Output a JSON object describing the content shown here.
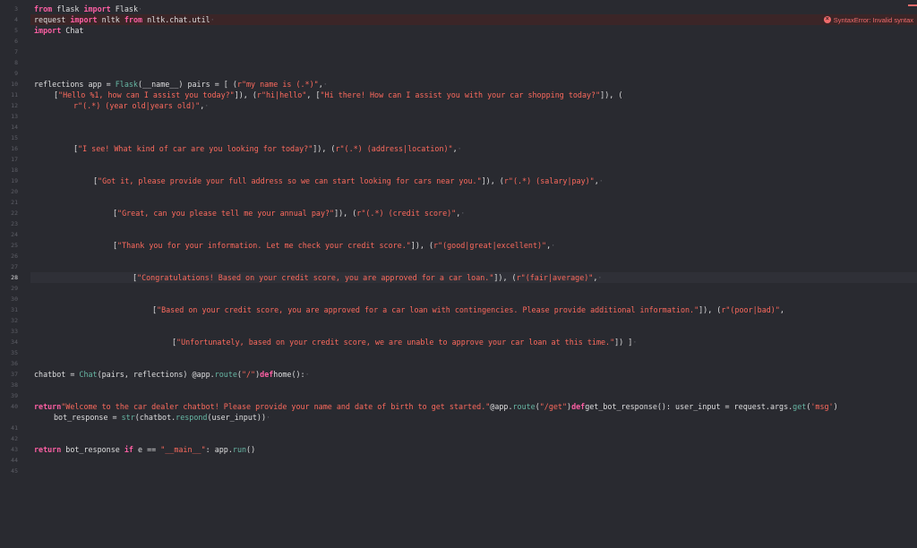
{
  "editor": {
    "line_numbers": [
      "3",
      "4",
      "5",
      "6",
      "7",
      "8",
      "9",
      "10",
      "11",
      "12",
      "13",
      "14",
      "15",
      "16",
      "17",
      "18",
      "19",
      "20",
      "21",
      "22",
      "23",
      "24",
      "25",
      "26",
      "27",
      "28",
      "29",
      "30",
      "31",
      "32",
      "33",
      "34",
      "35",
      "36",
      "37",
      "38",
      "39",
      "40",
      "",
      "41",
      "42",
      "43",
      "44",
      "45"
    ],
    "current_line": "28",
    "error_line": "4",
    "error_message": "SyntaxError: Invalid syntax",
    "lines": [
      {
        "no": "3",
        "indent": 0,
        "tokens": [
          {
            "t": "kw",
            "v": "from"
          },
          {
            "t": "p",
            "v": " flask "
          },
          {
            "t": "kw",
            "v": "import"
          },
          {
            "t": "p",
            "v": " Flask"
          },
          {
            "t": "ws",
            "v": "·"
          }
        ]
      },
      {
        "no": "4",
        "indent": 0,
        "tokens": [
          {
            "t": "p",
            "v": "request "
          },
          {
            "t": "kw",
            "v": "import"
          },
          {
            "t": "p",
            "v": " nltk "
          },
          {
            "t": "kw",
            "v": "from"
          },
          {
            "t": "p",
            "v": " nltk.chat.util"
          },
          {
            "t": "ws",
            "v": "·"
          }
        ]
      },
      {
        "no": "5",
        "indent": 0,
        "tokens": [
          {
            "t": "kw",
            "v": "import"
          },
          {
            "t": "p",
            "v": " Chat"
          }
        ]
      },
      {
        "no": "10",
        "indent": 0,
        "tokens": [
          {
            "t": "p",
            "v": "reflections app = "
          },
          {
            "t": "fn",
            "v": "Flask"
          },
          {
            "t": "p",
            "v": "(__name__) pairs = [ ("
          },
          {
            "t": "str",
            "v": "r\"my name is (.*)\""
          },
          {
            "t": "p",
            "v": ","
          },
          {
            "t": "ws",
            "v": "·"
          }
        ]
      },
      {
        "no": "11",
        "indent": 22,
        "tokens": [
          {
            "t": "p",
            "v": "["
          },
          {
            "t": "str",
            "v": "\"Hello %1, how can I assist you today?\""
          },
          {
            "t": "p",
            "v": "]), ("
          },
          {
            "t": "str",
            "v": "r\"hi|hello\""
          },
          {
            "t": "p",
            "v": ", ["
          },
          {
            "t": "str",
            "v": "\"Hi there! How can I assist you with your car shopping today?\""
          },
          {
            "t": "p",
            "v": "]), ("
          }
        ]
      },
      {
        "no": "12",
        "indent": 44,
        "tokens": [
          {
            "t": "str",
            "v": "r\"(.*) (year old|years old)\""
          },
          {
            "t": "p",
            "v": ","
          },
          {
            "t": "ws",
            "v": "·"
          }
        ]
      },
      {
        "no": "16",
        "indent": 44,
        "tokens": [
          {
            "t": "p",
            "v": "["
          },
          {
            "t": "str",
            "v": "\"I see! What kind of car are you looking for today?\""
          },
          {
            "t": "p",
            "v": "]), ("
          },
          {
            "t": "str",
            "v": "r\"(.*) (address|location)\""
          },
          {
            "t": "p",
            "v": ","
          },
          {
            "t": "ws",
            "v": "·"
          }
        ]
      },
      {
        "no": "19",
        "indent": 66,
        "tokens": [
          {
            "t": "p",
            "v": "["
          },
          {
            "t": "str",
            "v": "\"Got it, please provide your full address so we can start looking for cars near you.\""
          },
          {
            "t": "p",
            "v": "]), ("
          },
          {
            "t": "str",
            "v": "r\"(.*) (salary|pay)\""
          },
          {
            "t": "p",
            "v": ","
          },
          {
            "t": "ws",
            "v": "·"
          }
        ]
      },
      {
        "no": "22",
        "indent": 88,
        "tokens": [
          {
            "t": "p",
            "v": "["
          },
          {
            "t": "str",
            "v": "\"Great, can you please tell me your annual pay?\""
          },
          {
            "t": "p",
            "v": "]), ("
          },
          {
            "t": "str",
            "v": "r\"(.*) (credit score)\""
          },
          {
            "t": "p",
            "v": ","
          },
          {
            "t": "ws",
            "v": "·"
          }
        ]
      },
      {
        "no": "25",
        "indent": 88,
        "tokens": [
          {
            "t": "p",
            "v": "["
          },
          {
            "t": "str",
            "v": "\"Thank you for your information. Let me check your credit score.\""
          },
          {
            "t": "p",
            "v": "]), ("
          },
          {
            "t": "str",
            "v": "r\"(good|great|excellent)\""
          },
          {
            "t": "p",
            "v": ","
          },
          {
            "t": "ws",
            "v": "·"
          }
        ]
      },
      {
        "no": "28",
        "indent": 110,
        "tokens": [
          {
            "t": "p",
            "v": "["
          },
          {
            "t": "str",
            "v": "\"Congratulations! Based on your credit score, you are approved for a car loan.\""
          },
          {
            "t": "p",
            "v": "]), ("
          },
          {
            "t": "str",
            "v": "r\"(fair|average)\""
          },
          {
            "t": "p",
            "v": ","
          },
          {
            "t": "ws",
            "v": "·"
          }
        ]
      },
      {
        "no": "31",
        "indent": 132,
        "tokens": [
          {
            "t": "p",
            "v": "["
          },
          {
            "t": "str",
            "v": "\"Based on your credit score, you are approved for a car loan with contingencies. Please provide additional information.\""
          },
          {
            "t": "p",
            "v": "]), ("
          },
          {
            "t": "str",
            "v": "r\"(poor|bad)\""
          },
          {
            "t": "p",
            "v": ","
          }
        ]
      },
      {
        "no": "34",
        "indent": 154,
        "tokens": [
          {
            "t": "p",
            "v": "["
          },
          {
            "t": "str",
            "v": "\"Unfortunately, based on your credit score, we are unable to approve your car loan at this time.\""
          },
          {
            "t": "p",
            "v": "]) ]"
          },
          {
            "t": "ws",
            "v": "·"
          }
        ]
      },
      {
        "no": "37",
        "indent": 0,
        "tokens": [
          {
            "t": "p",
            "v": "chatbot = "
          },
          {
            "t": "fn",
            "v": "Chat"
          },
          {
            "t": "p",
            "v": "(pairs, reflections) @app."
          },
          {
            "t": "fn",
            "v": "route"
          },
          {
            "t": "p",
            "v": "("
          },
          {
            "t": "str",
            "v": "\"/\""
          },
          {
            "t": "p",
            "v": ")"
          },
          {
            "t": "kw",
            "v": "def"
          },
          {
            "t": "p",
            "v": "home():"
          },
          {
            "t": "ws",
            "v": "·"
          }
        ]
      },
      {
        "no": "40",
        "indent": 0,
        "tokens": [
          {
            "t": "kw",
            "v": "return"
          },
          {
            "t": "str",
            "v": "\"Welcome to the car dealer chatbot! Please provide your name and date of birth to get started.\""
          },
          {
            "t": "p",
            "v": "@app."
          },
          {
            "t": "fn",
            "v": "route"
          },
          {
            "t": "p",
            "v": "("
          },
          {
            "t": "str",
            "v": "\"/get\""
          },
          {
            "t": "p",
            "v": ")"
          },
          {
            "t": "kw",
            "v": "def"
          },
          {
            "t": "p",
            "v": "get_bot_response(): user_input = request.args."
          },
          {
            "t": "fn",
            "v": "get"
          },
          {
            "t": "p",
            "v": "("
          },
          {
            "t": "str",
            "v": "'msg'"
          },
          {
            "t": "p",
            "v": ")"
          }
        ]
      },
      {
        "no": "",
        "indent": 22,
        "tokens": [
          {
            "t": "p",
            "v": "bot_response = "
          },
          {
            "t": "fn",
            "v": "str"
          },
          {
            "t": "p",
            "v": "(chatbot."
          },
          {
            "t": "fn",
            "v": "respond"
          },
          {
            "t": "p",
            "v": "(user_input))"
          },
          {
            "t": "ws",
            "v": "·"
          }
        ]
      },
      {
        "no": "43",
        "indent": 0,
        "tokens": [
          {
            "t": "kw",
            "v": "return"
          },
          {
            "t": "p",
            "v": " bot_response "
          },
          {
            "t": "kw",
            "v": "if"
          },
          {
            "t": "p",
            "v": " e == "
          },
          {
            "t": "str",
            "v": "\"__main__\""
          },
          {
            "t": "p",
            "v": ": app."
          },
          {
            "t": "fn",
            "v": "run"
          },
          {
            "t": "p",
            "v": "()"
          }
        ]
      }
    ]
  }
}
